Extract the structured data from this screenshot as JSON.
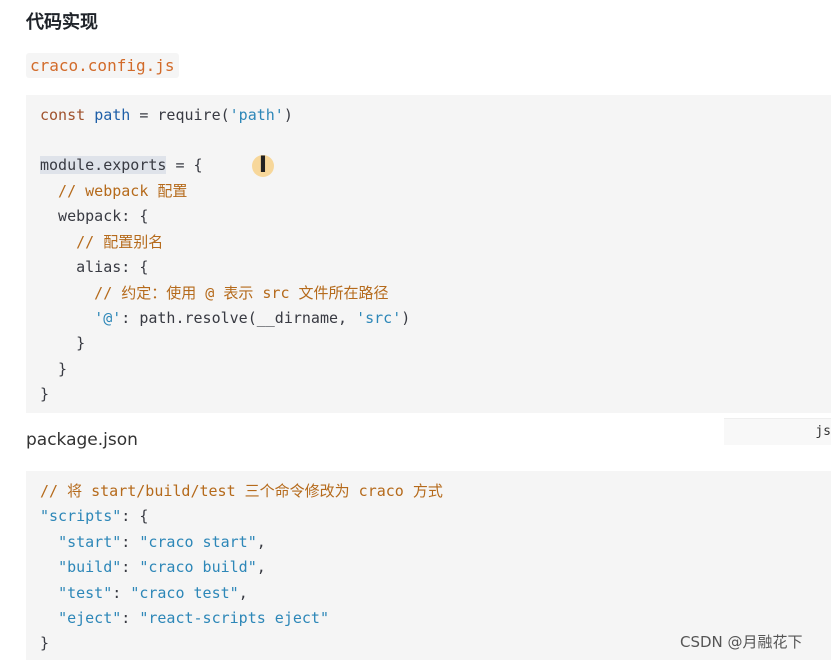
{
  "heading": "代码实现",
  "file_chip": "craco.config.js",
  "code1": {
    "l1a": "const",
    "l1b": "path",
    "l1c": " = ",
    "l1d": "require",
    "l1e": "(",
    "l1f": "'path'",
    "l1g": ")",
    "l3a": "module.exports",
    "l3b": " = {",
    "l4": "  // webpack 配置",
    "l5": "  webpack: {",
    "l6": "    // 配置别名",
    "l7": "    alias: {",
    "l8": "      // 约定：使用 @ 表示 src 文件所在路径",
    "l9a": "      ",
    "l9b": "'@'",
    "l9c": ": path.resolve(__dirname, ",
    "l9d": "'src'",
    "l9e": ")",
    "l10": "    }",
    "l11": "  }",
    "l12": "}"
  },
  "lang_tag": "js",
  "pkg_label": "package.json",
  "code2": {
    "l1": "// 将 start/build/test 三个命令修改为 craco 方式",
    "l2a": "\"scripts\"",
    "l2b": ": {",
    "l3a": "  ",
    "l3b": "\"start\"",
    "l3c": ": ",
    "l3d": "\"craco start\"",
    "l3e": ",",
    "l4a": "  ",
    "l4b": "\"build\"",
    "l4c": ": ",
    "l4d": "\"craco build\"",
    "l4e": ",",
    "l5a": "  ",
    "l5b": "\"test\"",
    "l5c": ": ",
    "l5d": "\"craco test\"",
    "l5e": ",",
    "l6a": "  ",
    "l6b": "\"eject\"",
    "l6c": ": ",
    "l6d": "\"react-scripts eject\"",
    "l7": "}"
  },
  "watermark": "CSDN @月融花下"
}
